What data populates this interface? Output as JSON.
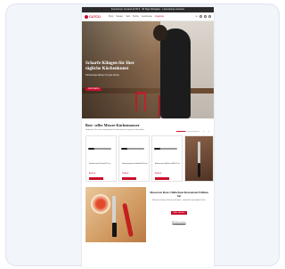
{
  "topbar": {
    "text": "Kostenloser Versand ab 50 € · 30 Tage Rückgabe · Lebenslange Garantie"
  },
  "header": {
    "logo": "CUTCO",
    "nav": [
      "Shop",
      "Messer",
      "Sets",
      "Küche",
      "Geschenke",
      "Angebote"
    ],
    "lang": "DE"
  },
  "hero": {
    "title": "Scharfe Klingen für Ihre tägliche Küchenkunst",
    "subtitle": "Hochwertige Messer für jede Küche",
    "cta": "Jetzt kaufen"
  },
  "bestsellers": {
    "title": "Best- seller Messer Küchenmesser",
    "description": "Entdecken Sie unsere beliebtesten Küchenmesser für präzises Schneiden."
  },
  "products": [
    {
      "name": "Kochmesser Klassik 20 cm",
      "price": "89,00 €"
    },
    {
      "name": "Santokumesser Edelstahl 18 cm",
      "price": "79,00 €"
    },
    {
      "name": "Brotmesser Wellenschliff 22 cm",
      "price": "69,00 €"
    }
  ],
  "feature": {
    "title": "Messerset Rote Chilischote Restaurant Edition Set",
    "body": "Perfekt für Gemüse, Fleisch und Kräuter – entwickelt für die tägliche Küche.",
    "cta": "Mehr erfahren",
    "link": "Alle Sets ansehen",
    "note": "Versandkostenfrei"
  },
  "colors": {
    "brand": "#c8102e"
  }
}
